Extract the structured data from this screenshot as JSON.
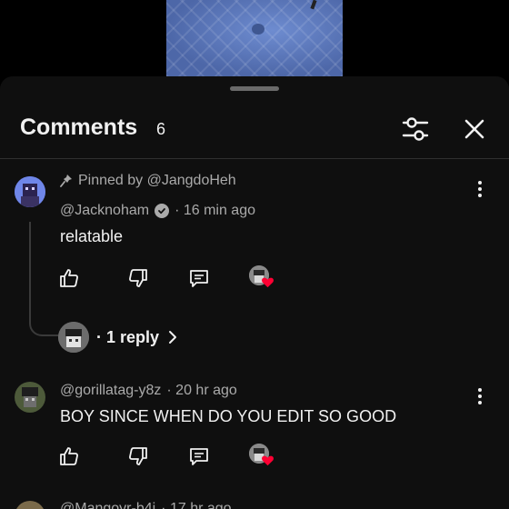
{
  "sheet": {
    "title": "Comments",
    "count": "6"
  },
  "comments": [
    {
      "pinned_text": "Pinned by @JangdoHeh",
      "author": "@Jacknoham",
      "verified": true,
      "time": "· 16 min ago",
      "text": "relatable",
      "replies_label": "· 1 reply",
      "hearted_by_creator": true
    },
    {
      "author": "@gorillatag-y8z",
      "time": "· 20 hr ago",
      "text": "BOY SINCE WHEN DO YOU EDIT SO GOOD",
      "hearted_by_creator": true
    },
    {
      "author": "@Mangoyr-b4i",
      "time": "· 17 hr ago"
    }
  ],
  "colors": {
    "sheet_background": "#0f0f0f",
    "text_primary": "#f1f1f1",
    "text_secondary": "#aaaaaa",
    "heart": "#ff0033"
  },
  "icons": {
    "filter": "sliders-icon",
    "close": "close-icon",
    "pin": "pin-icon",
    "like": "thumbs-up-icon",
    "dislike": "thumbs-down-icon",
    "reply": "reply-bubble-icon",
    "more": "vertical-ellipsis-icon",
    "chevron": "chevron-right-icon"
  }
}
